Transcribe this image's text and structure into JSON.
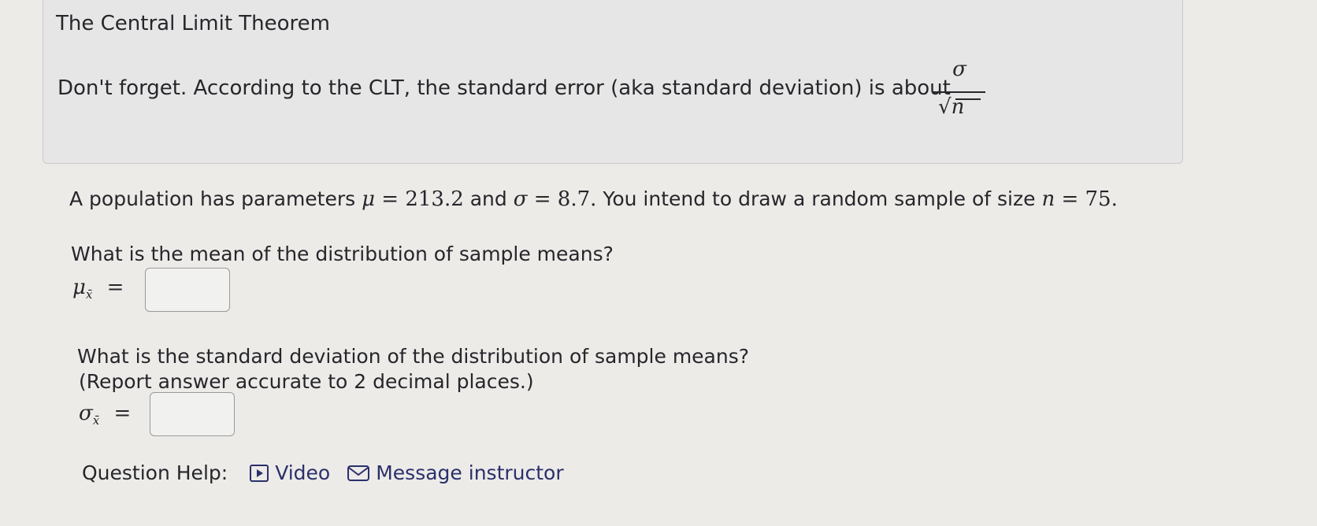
{
  "info_box": {
    "title": "The Central Limit Theorem",
    "text": "Don't forget. According to the CLT, the standard error (aka standard deviation) is about",
    "formula": {
      "numerator": "σ",
      "denominator_symbol": "√",
      "denominator_var": "n"
    }
  },
  "problem": {
    "statement_prefix": "A population has parameters",
    "mu_symbol": "μ",
    "mu_value": "= 213.2",
    "and_text": "and",
    "sigma_symbol": "σ",
    "sigma_value": "= 8.7.",
    "sample_text": "You intend to draw a random sample of size",
    "n_symbol": "n",
    "n_value": "= 75."
  },
  "question1": {
    "text": "What is the mean of the distribution of sample means?",
    "lhs_symbol": "μ",
    "lhs_sub": "x̄",
    "equals": "=",
    "answer_value": ""
  },
  "question2": {
    "text_line1": "What is the standard deviation of the distribution of sample means?",
    "text_line2": "(Report answer accurate to 2 decimal places.)",
    "lhs_symbol": "σ",
    "lhs_sub": "x̄",
    "equals": "=",
    "answer_value": ""
  },
  "help": {
    "label": "Question Help:",
    "video_label": "Video",
    "video_icon": "play-icon",
    "message_label": "Message instructor",
    "message_icon": "envelope-icon",
    "link_color": "#2b2f6b"
  }
}
